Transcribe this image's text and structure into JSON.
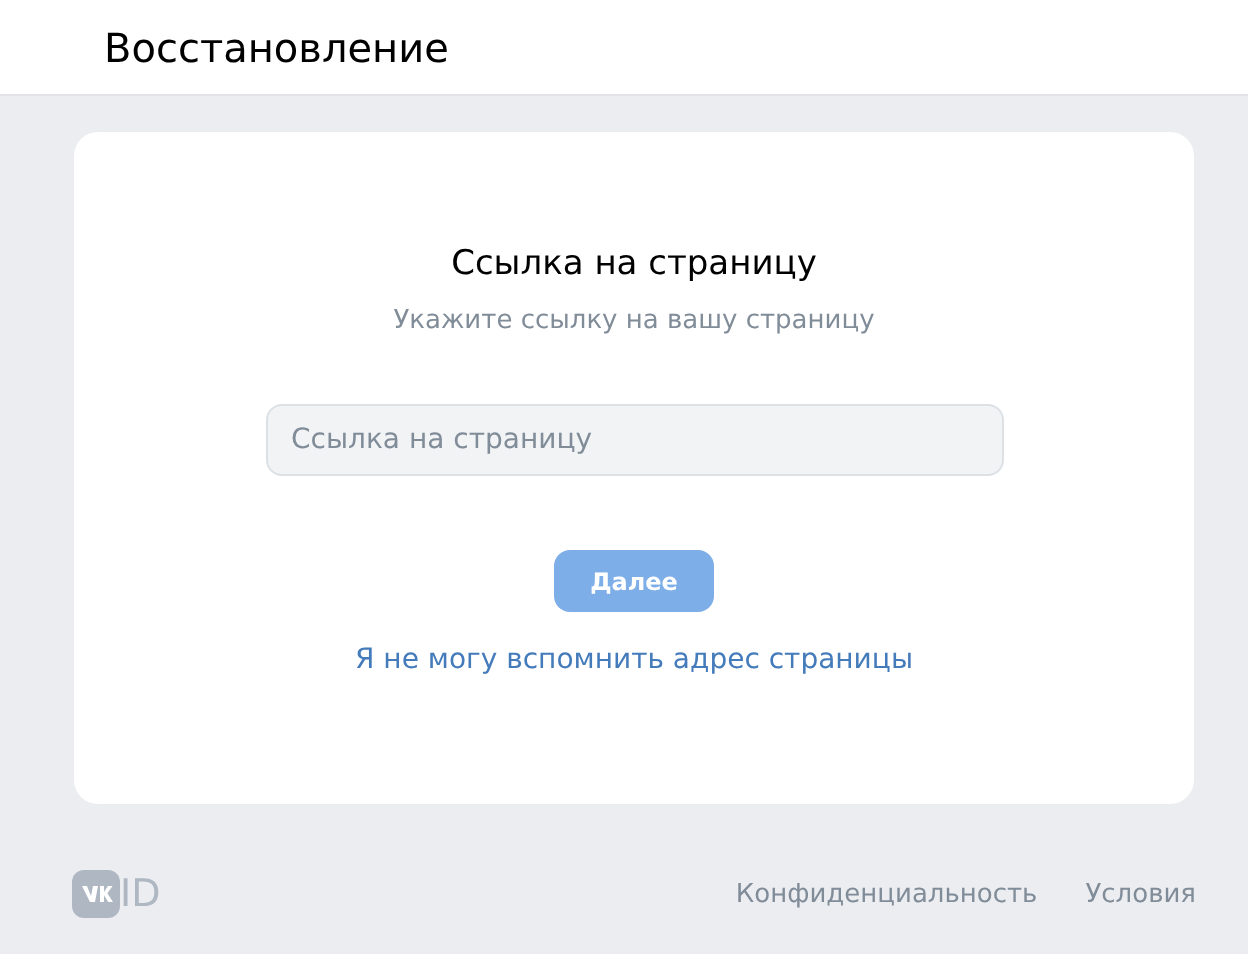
{
  "header": {
    "title": "Восстановление"
  },
  "card": {
    "title": "Ссылка на страницу",
    "subtitle": "Укажите ссылку на вашу страницу",
    "input": {
      "placeholder": "Ссылка на страницу"
    },
    "button": {
      "label": "Далее",
      "disabled": true
    },
    "link": "Я не могу вспомнить адрес страницы"
  },
  "footer": {
    "logo_text": "ID",
    "links": [
      "Конфиденциальность",
      "Условия"
    ]
  }
}
